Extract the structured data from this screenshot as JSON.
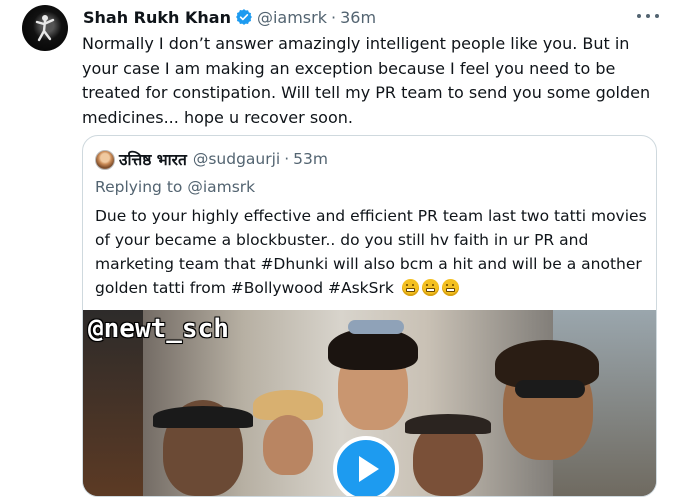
{
  "tweet": {
    "author_name": "Shah Rukh Khan",
    "handle": "@iamsrk",
    "separator": "·",
    "time": "36m",
    "text": "Normally I don’t answer amazingly intelligent people like you. But in your case I am making an exception because I feel you need to be treated for constipation. Will tell my PR team to send you some golden medicines... hope u recover soon.",
    "verified_color": "#1d9bf0"
  },
  "quote": {
    "author_name": "उत्तिष्ठ भारत",
    "handle": "@sudgaurji",
    "separator": "·",
    "time": "53m",
    "replying_label": "Replying to",
    "replying_mention": "@iamsrk",
    "text": "Due to your highly effective and efficient PR team last two tatti movies of your became a blockbuster.. do you still hv faith in ur PR and marketing team that #Dhunki will also bcm a hit and will be a another golden tatti from #Bollywood  #AskSrk",
    "emojis": [
      "grimacing-face-icon",
      "grimacing-face-icon",
      "grimacing-face-icon"
    ]
  },
  "media": {
    "watermark": "@newt_sch",
    "play_color": "#1d9bf0"
  },
  "icons": {
    "more": "more-options-icon",
    "verified": "verified-badge-icon",
    "play": "play-icon"
  }
}
